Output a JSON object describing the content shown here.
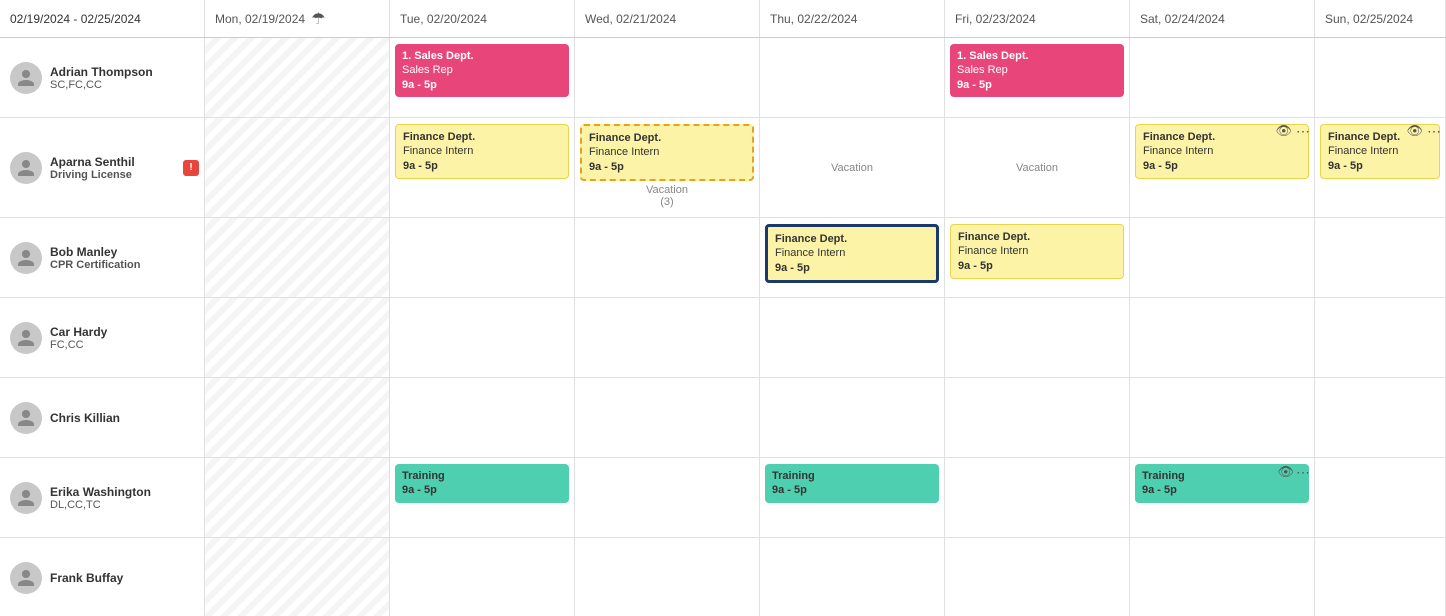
{
  "header": {
    "week_range": "02/19/2024 - 02/25/2024",
    "days": [
      {
        "label": "Mon, 02/19/2024",
        "has_icon": true
      },
      {
        "label": "Tue, 02/20/2024",
        "has_icon": false
      },
      {
        "label": "Wed, 02/21/2024",
        "has_icon": false
      },
      {
        "label": "Thu, 02/22/2024",
        "has_icon": false
      },
      {
        "label": "Fri, 02/23/2024",
        "has_icon": false
      },
      {
        "label": "Sat, 02/24/2024",
        "has_icon": false
      },
      {
        "label": "Sun, 02/25/2024",
        "has_icon": false
      }
    ]
  },
  "people": [
    {
      "name": "Adrian Thompson",
      "tags": "SC,FC,CC",
      "tags_bold": false,
      "events": {
        "mon": null,
        "tue": {
          "type": "pink",
          "dept": "1. Sales Dept.",
          "role": "Sales Rep",
          "time": "9a - 5p"
        },
        "wed": null,
        "thu": null,
        "fri": {
          "type": "pink",
          "dept": "1. Sales Dept.",
          "role": "Sales Rep",
          "time": "9a - 5p"
        },
        "sat": null,
        "sun": null
      }
    },
    {
      "name": "Aparna Senthil",
      "tags": "Driving License",
      "tags_bold": true,
      "has_alert": true,
      "events": {
        "mon": null,
        "tue": {
          "type": "yellow",
          "dept": "Finance Dept.",
          "role": "Finance Intern",
          "time": "9a - 5p"
        },
        "wed": {
          "type": "yellow-dashed",
          "dept": "Finance Dept.",
          "role": "Finance Intern",
          "time": "9a - 5p",
          "vacation_below": "Vacation\n(3)"
        },
        "thu": {
          "type": "vacation",
          "label": "Vacation"
        },
        "fri": {
          "type": "vacation",
          "label": "Vacation"
        },
        "sat": {
          "type": "yellow",
          "dept": "Finance Dept.",
          "role": "Finance Intern",
          "time": "9a - 5p",
          "has_eye": true,
          "has_dot": true
        },
        "sun": {
          "type": "yellow",
          "dept": "Finance Dept.",
          "role": "Finance Intern",
          "time": "9a - 5p",
          "has_eye": true,
          "has_dot": true
        }
      }
    },
    {
      "name": "Bob Manley",
      "tags": "CPR Certification",
      "tags_bold": true,
      "events": {
        "mon": null,
        "tue": null,
        "wed": null,
        "thu": {
          "type": "blue-outline",
          "dept": "Finance Dept.",
          "role": "Finance Intern",
          "time": "9a - 5p"
        },
        "fri": {
          "type": "yellow",
          "dept": "Finance Dept.",
          "role": "Finance Intern",
          "time": "9a - 5p"
        },
        "sat": null,
        "sun": null
      }
    },
    {
      "name": "Car Hardy",
      "tags": "FC,CC",
      "tags_bold": false,
      "events": {
        "mon": null,
        "tue": null,
        "wed": null,
        "thu": null,
        "fri": null,
        "sat": null,
        "sun": null
      }
    },
    {
      "name": "Chris Killian",
      "tags": "",
      "tags_bold": false,
      "events": {
        "mon": null,
        "tue": null,
        "wed": null,
        "thu": null,
        "fri": null,
        "sat": null,
        "sun": null
      }
    },
    {
      "name": "Erika Washington",
      "tags": "DL,CC,TC",
      "tags_bold": false,
      "events": {
        "mon": null,
        "tue": {
          "type": "teal",
          "dept": "Training",
          "role": "",
          "time": "9a - 5p"
        },
        "wed": null,
        "thu": {
          "type": "teal",
          "dept": "Training",
          "role": "",
          "time": "9a - 5p"
        },
        "fri": null,
        "sat": {
          "type": "teal",
          "dept": "Training",
          "role": "",
          "time": "9a - 5p",
          "has_eye": true
        },
        "sun": null
      }
    },
    {
      "name": "Frank Buffay",
      "tags": "",
      "tags_bold": false,
      "events": {
        "mon": null,
        "tue": null,
        "wed": null,
        "thu": null,
        "fri": null,
        "sat": null,
        "sun": null
      }
    }
  ],
  "icons": {
    "umbrella": "☂",
    "eye": "👁",
    "dots": "⋯",
    "alert": "!"
  }
}
